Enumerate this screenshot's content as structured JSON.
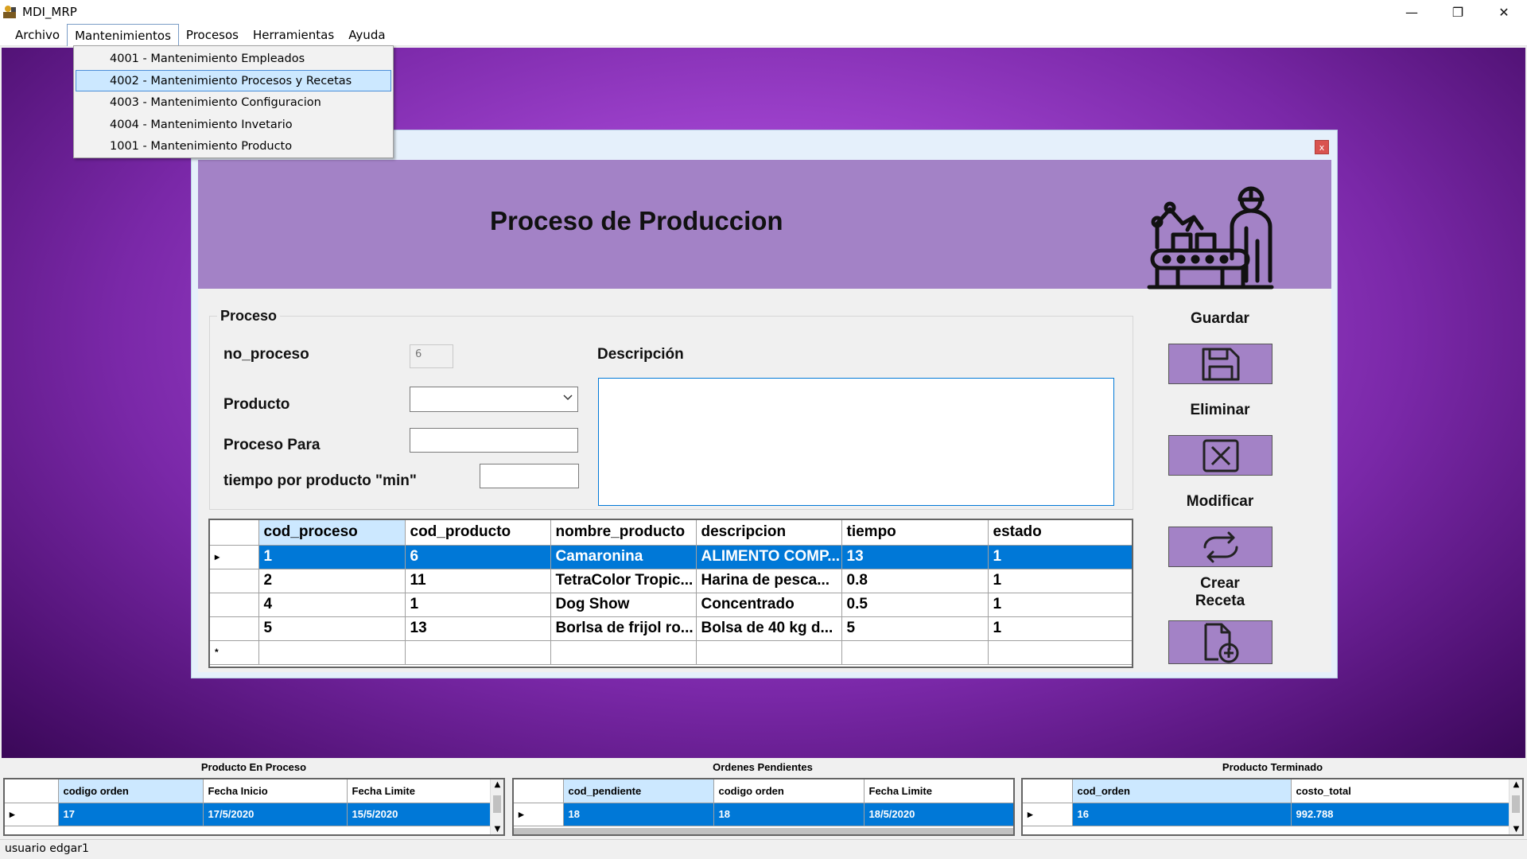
{
  "window": {
    "title": "MDI_MRP",
    "minimize": "—",
    "restore": "❐",
    "close": "✕"
  },
  "menu": {
    "items": [
      "Archivo",
      "Mantenimientos",
      "Procesos",
      "Herramientas",
      "Ayuda"
    ],
    "dropdown": [
      "4001 - Mantenimiento Empleados",
      "4002 - Mantenimiento Procesos y Recetas",
      "4003 - Mantenimiento Configuracion",
      "4004 - Mantenimiento Invetario",
      "1001 - Mantenimiento Producto"
    ]
  },
  "form": {
    "close_label": "x",
    "header_title": "Proceso de Produccion",
    "group_title": "Proceso",
    "labels": {
      "no_proceso": "no_proceso",
      "producto": "Producto",
      "proceso_para": "Proceso Para",
      "tiempo": "tiempo por producto \"min\"",
      "descripcion": "Descripción"
    },
    "fields": {
      "no_proceso": "6",
      "producto": "",
      "proceso_para": "",
      "tiempo": "",
      "descripcion": ""
    },
    "grid": {
      "columns": [
        "cod_proceso",
        "cod_producto",
        "nombre_producto",
        "descripcion",
        "tiempo",
        "estado"
      ],
      "rows": [
        [
          "1",
          "6",
          "Camaronina",
          "ALIMENTO COMP...",
          "13",
          "1"
        ],
        [
          "2",
          "11",
          "TetraColor Tropic...",
          "Harina de pesca...",
          "0.8",
          "1"
        ],
        [
          "4",
          "1",
          "Dog Show",
          "Concentrado",
          "0.5",
          "1"
        ],
        [
          "5",
          "13",
          "Borlsa de frijol ro...",
          "Bolsa de 40 kg d...",
          "5",
          "1"
        ]
      ],
      "new_row_marker": "*",
      "current_row_marker": "▸"
    },
    "buttons": {
      "guardar": "Guardar",
      "eliminar": "Eliminar",
      "modificar": "Modificar",
      "crear_receta_1": "Crear",
      "crear_receta_2": "Receta"
    }
  },
  "bottom": {
    "producto_en_proceso": {
      "title": "Producto En Proceso",
      "columns": [
        "codigo orden",
        "Fecha Inicio",
        "Fecha Limite"
      ],
      "rows": [
        [
          "17",
          "17/5/2020",
          "15/5/2020"
        ]
      ]
    },
    "ordenes_pendientes": {
      "title": "Ordenes Pendientes",
      "columns": [
        "cod_pendiente",
        "codigo orden",
        "Fecha Limite"
      ],
      "rows": [
        [
          "18",
          "18",
          "18/5/2020"
        ]
      ]
    },
    "producto_terminado": {
      "title": "Producto Terminado",
      "columns": [
        "cod_orden",
        "costo_total"
      ],
      "rows": [
        [
          "16",
          "992.788"
        ]
      ]
    }
  },
  "status": {
    "user_label": "usuario",
    "user_value": "edgar1"
  }
}
